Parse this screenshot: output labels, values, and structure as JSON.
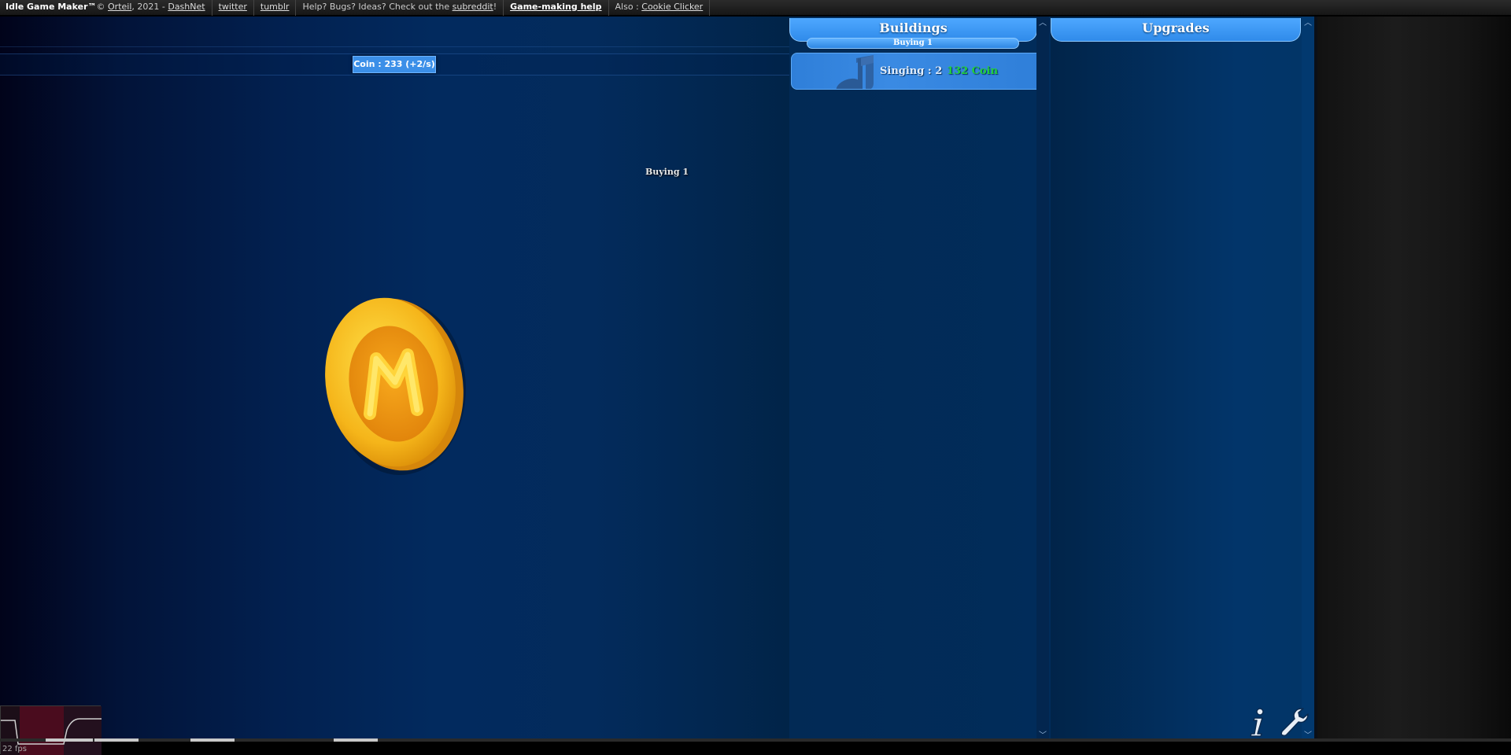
{
  "topbar": {
    "brand": "Idle Game Maker™",
    "copyright": "© ",
    "author": "Orteil",
    "year_sep": ", 2021 - ",
    "company": "DashNet",
    "twitter": "twitter",
    "tumblr": "tumblr",
    "help_prefix": "Help? Bugs? Ideas? Check out the ",
    "subreddit": "subreddit",
    "help_suffix": "!",
    "game_making_help": "Game-making help",
    "also_prefix": "Also : ",
    "cookie_clicker": "Cookie Clicker"
  },
  "main": {
    "coin_counter": "Coin : 233 (+2/s)",
    "buying_label": "Buying 1",
    "coin_icon": "coin-icon"
  },
  "buildings": {
    "header": "Buildings",
    "buying_mode": "Buying 1",
    "items": [
      {
        "name": "Singing : 2",
        "cost": "132 Coin",
        "icon": "music-note-icon"
      }
    ]
  },
  "upgrades": {
    "header": "Upgrades"
  },
  "corner": {
    "info_icon": "info-icon",
    "settings_icon": "wrench-icon"
  },
  "fps": {
    "label": "22 fps"
  },
  "colors": {
    "accent": "#3b8fe8",
    "cost_green": "#22cf3a",
    "panel_blue": "#02356a"
  }
}
